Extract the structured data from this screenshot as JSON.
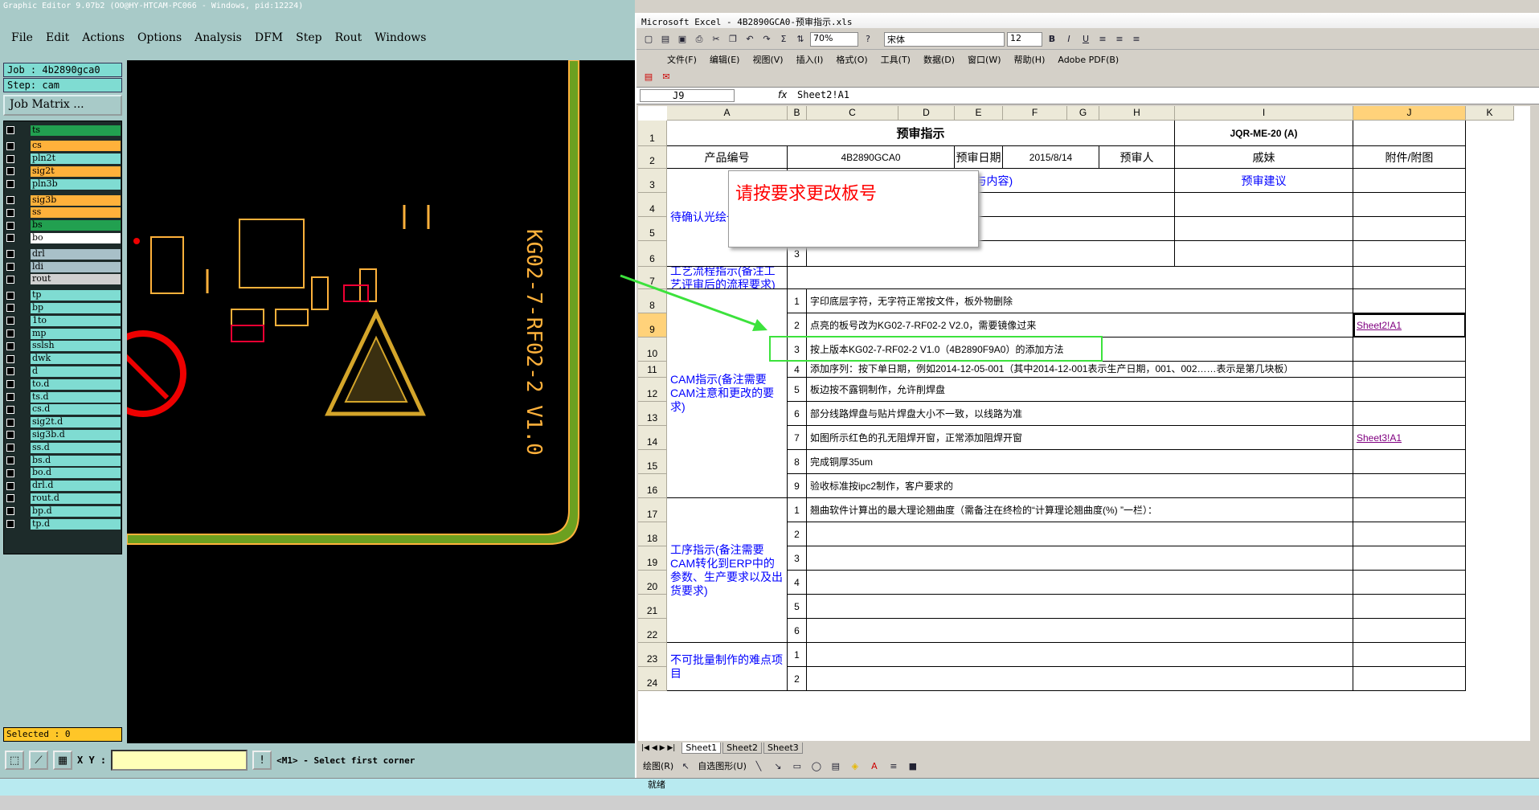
{
  "genesis": {
    "title": "Graphic Editor 9.07b2 (OO@HY-HTCAM-PC066 - Windows, pid:12224)",
    "menu": [
      "File",
      "Edit",
      "Actions",
      "Options",
      "Analysis",
      "DFM",
      "Step",
      "Rout",
      "Windows"
    ],
    "job": "Job : 4b2890gca0",
    "step": "Step: cam",
    "job_matrix": "Job Matrix ...",
    "layers": [
      {
        "name": "ts",
        "color": "#22a050"
      },
      {
        "name": "cs",
        "color": "#ffb13b"
      },
      {
        "name": "pln2t",
        "color": "#7fdcd2"
      },
      {
        "name": "sig2t",
        "color": "#ffb13b"
      },
      {
        "name": "pln3b",
        "color": "#7fdcd2"
      },
      {
        "name": "sig3b",
        "color": "#ffb13b"
      },
      {
        "name": "ss",
        "color": "#ffb13b"
      },
      {
        "name": "bs",
        "color": "#22a050"
      },
      {
        "name": "bo",
        "color": "#ffffff"
      },
      {
        "name": "drl",
        "color": "#a8c0c8"
      },
      {
        "name": "ldi",
        "color": "#a8c0c8"
      },
      {
        "name": "rout",
        "color": "#d0d0d0"
      },
      {
        "name": "tp",
        "color": "#7fdcd2"
      },
      {
        "name": "bp",
        "color": "#7fdcd2"
      },
      {
        "name": "1to",
        "color": "#7fdcd2"
      },
      {
        "name": "mp",
        "color": "#7fdcd2"
      },
      {
        "name": "sslsh",
        "color": "#7fdcd2"
      },
      {
        "name": "dwk",
        "color": "#7fdcd2"
      },
      {
        "name": "d",
        "color": "#7fdcd2"
      },
      {
        "name": "to.d",
        "color": "#7fdcd2"
      },
      {
        "name": "ts.d",
        "color": "#7fdcd2"
      },
      {
        "name": "cs.d",
        "color": "#7fdcd2"
      },
      {
        "name": "sig2t.d",
        "color": "#7fdcd2"
      },
      {
        "name": "sig3b.d",
        "color": "#7fdcd2"
      },
      {
        "name": "ss.d",
        "color": "#7fdcd2"
      },
      {
        "name": "bs.d",
        "color": "#7fdcd2"
      },
      {
        "name": "bo.d",
        "color": "#7fdcd2"
      },
      {
        "name": "drl.d",
        "color": "#7fdcd2"
      },
      {
        "name": "rout.d",
        "color": "#7fdcd2"
      },
      {
        "name": "bp.d",
        "color": "#7fdcd2"
      },
      {
        "name": "tp.d",
        "color": "#7fdcd2"
      }
    ],
    "pcb_text": "KG02-7-RF02-2 V1.0",
    "selected": "Selected : 0",
    "xy_label": "X Y :",
    "prompt": "<M1> - Select first corner"
  },
  "excel": {
    "title": "Microsoft Excel - 4B2890GCA0-预审指示.xls",
    "menu": [
      "文件(F)",
      "编辑(E)",
      "视图(V)",
      "插入(I)",
      "格式(O)",
      "工具(T)",
      "数据(D)",
      "窗口(W)",
      "帮助(H)",
      "Adobe PDF(B)"
    ],
    "zoom": "70%",
    "font": "宋体",
    "font_size": "12",
    "name_box": "J9",
    "formula": "Sheet2!A1",
    "columns": [
      "A",
      "B",
      "C",
      "D",
      "E",
      "F",
      "G",
      "H",
      "I",
      "J",
      "K"
    ],
    "rows": [
      "1",
      "2",
      "3",
      "4",
      "5",
      "6",
      "7",
      "8",
      "9",
      "10",
      "11",
      "12",
      "13",
      "14",
      "15",
      "16",
      "17",
      "18",
      "19",
      "20",
      "21",
      "22",
      "23",
      "24"
    ],
    "cells": {
      "title": "预审指示",
      "code": "JQR-ME-20 (A)",
      "product_no_label": "产品编号",
      "product_no": "4B2890GCA0",
      "date_label": "预审日期",
      "date": "2015/8/14",
      "reviewer_label": "预审人",
      "reviewer": "戚妹",
      "attach_label": "附件/附图",
      "reason_label": "(原因与内容)",
      "suggest_label": "预审建议",
      "confirm_label": "待确认光绘一起确认",
      "item3": "3",
      "process_label": "工艺流程指示(备注工艺评审后的流程要求)",
      "cam_label": "CAM指示(备注需要CAM注意和更改的要求)",
      "cam_items": [
        {
          "n": "1",
          "t": "字印底层字符，无字符正常按文件，板外物删除",
          "link": ""
        },
        {
          "n": "2",
          "t": "点亮的板号改为KG02-7-RF02-2 V2.0，需要镜像过来",
          "link": "Sheet2!A1"
        },
        {
          "n": "3",
          "t": "按上版本KG02-7-RF02-2 V1.0（4B2890F9A0）的添加方法",
          "link": ""
        },
        {
          "n": "4",
          "t": "添加序列：按下单日期，例如2014-12-05-001（其中2014-12-001表示生产日期，001、002……表示是第几块板）",
          "link": ""
        },
        {
          "n": "5",
          "t": "板边按不露铜制作，允许削焊盘",
          "link": ""
        },
        {
          "n": "6",
          "t": "部分线路焊盘与贴片焊盘大小不一致，以线路为准",
          "link": ""
        },
        {
          "n": "7",
          "t": "如图所示红色的孔无阻焊开窗，正常添加阻焊开窗",
          "link": "Sheet3!A1"
        },
        {
          "n": "8",
          "t": "完成铜厚35um",
          "link": ""
        },
        {
          "n": "9",
          "t": "验收标准按ipc2制作，客户要求的",
          "link": ""
        }
      ],
      "proc_label": "工序指示(备注需要CAM转化到ERP中的参数、生产要求以及出货要求)",
      "proc_items": [
        {
          "n": "1",
          "t": "翘曲软件计算出的最大理论翘曲度（需备注在终检的“计算理论翘曲度(%) ”一栏）："
        },
        {
          "n": "2",
          "t": ""
        },
        {
          "n": "3",
          "t": ""
        },
        {
          "n": "4",
          "t": ""
        },
        {
          "n": "5",
          "t": ""
        },
        {
          "n": "6",
          "t": ""
        }
      ],
      "hard_label": "不可批量制作的难点项目",
      "hard_items": [
        "1",
        "2"
      ]
    },
    "popup": "请按要求更改板号",
    "sheets": [
      "Sheet1",
      "Sheet2",
      "Sheet3"
    ],
    "drawbar": [
      "绘图(R)",
      "自选图形(U)"
    ],
    "status": "就绪"
  }
}
